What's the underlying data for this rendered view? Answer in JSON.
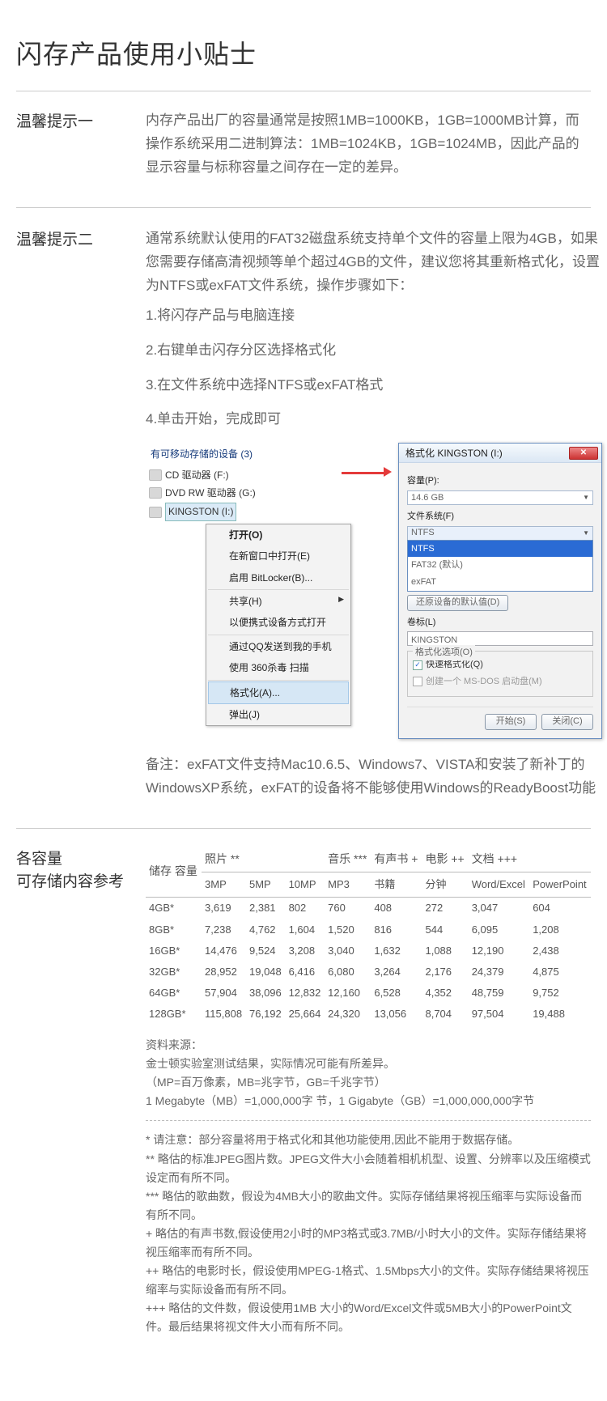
{
  "title": "闪存产品使用小贴士",
  "tip1": {
    "label": "温馨提示一",
    "body": "内存产品出厂的容量通常是按照1MB=1000KB，1GB=1000MB计算，而操作系统采用二进制算法：1MB=1024KB，1GB=1024MB，因此产品的显示容量与标称容量之间存在一定的差异。"
  },
  "tip2": {
    "label": "温馨提示二",
    "intro": "通常系统默认使用的FAT32磁盘系统支持单个文件的容量上限为4GB，如果您需要存储高清视频等单个超过4GB的文件，建议您将其重新格式化，设置为NTFS或exFAT文件系统，操作步骤如下：",
    "step1": "1.将闪存产品与电脑连接",
    "step2": "2.右键单击闪存分区选择格式化",
    "step3": "3.在文件系统中选择NTFS或exFAT格式",
    "step4": "4.单击开始，完成即可",
    "note": "备注：exFAT文件支持Mac10.6.5、Windows7、VISTA和安装了新补丁的WindowsXP系统，exFAT的设备将不能够使用Windows的ReadyBoost功能"
  },
  "context": {
    "devices_header": "有可移动存储的设备 (3)",
    "device_cd": "CD 驱动器 (F:)",
    "device_dvd": "DVD RW 驱动器 (G:)",
    "device_sel": "KINGSTON (I:)",
    "menu": {
      "open": "打开(O)",
      "open_new": "在新窗口中打开(E)",
      "bitlocker": "启用 BitLocker(B)...",
      "share": "共享(H)",
      "portable": "以便携式设备方式打开",
      "qq": "通过QQ发送到我的手机",
      "scan": "使用 360杀毒 扫描",
      "format": "格式化(A)...",
      "eject": "弹出(J)"
    }
  },
  "dialog": {
    "title": "格式化 KINGSTON (I:)",
    "capacity_label": "容量(P):",
    "capacity_value": "14.6 GB",
    "fs_label": "文件系统(F)",
    "fs_sel": "NTFS",
    "fs_opt1": "NTFS",
    "fs_opt2": "FAT32 (默认)",
    "fs_opt3": "exFAT",
    "restore_btn": "还原设备的默认值(D)",
    "vol_label": "卷标(L)",
    "vol_value": "KINGSTON",
    "opts_label": "格式化选项(O)",
    "quick": "快速格式化(Q)",
    "msdos": "创建一个 MS-DOS 启动盘(M)",
    "start": "开始(S)",
    "close": "关闭(C)"
  },
  "capacity": {
    "label_l1": "各容量",
    "label_l2": "可存储内容参考",
    "group": {
      "storage": "储存\n容量",
      "photo": "照片 **",
      "music": "音乐 ***",
      "audio": "有声书 +",
      "movie": "电影 ++",
      "doc": "文档 +++"
    },
    "sub": {
      "p3": "3MP",
      "p5": "5MP",
      "p10": "10MP",
      "mp3": "MP3",
      "book": "书籍",
      "min": "分钟",
      "we": "Word/Excel",
      "ppt": "PowerPoint"
    },
    "rows": [
      {
        "cap": "4GB*",
        "p3": "3,619",
        "p5": "2,381",
        "p10": "802",
        "mp3": "760",
        "book": "408",
        "min": "272",
        "we": "3,047",
        "ppt": "604"
      },
      {
        "cap": "8GB*",
        "p3": "7,238",
        "p5": "4,762",
        "p10": "1,604",
        "mp3": "1,520",
        "book": "816",
        "min": "544",
        "we": "6,095",
        "ppt": "1,208"
      },
      {
        "cap": "16GB*",
        "p3": "14,476",
        "p5": "9,524",
        "p10": "3,208",
        "mp3": "3,040",
        "book": "1,632",
        "min": "1,088",
        "we": "12,190",
        "ppt": "2,438"
      },
      {
        "cap": "32GB*",
        "p3": "28,952",
        "p5": "19,048",
        "p10": "6,416",
        "mp3": "6,080",
        "book": "3,264",
        "min": "2,176",
        "we": "24,379",
        "ppt": "4,875"
      },
      {
        "cap": "64GB*",
        "p3": "57,904",
        "p5": "38,096",
        "p10": "12,832",
        "mp3": "12,160",
        "book": "6,528",
        "min": "4,352",
        "we": "48,759",
        "ppt": "9,752"
      },
      {
        "cap": "128GB*",
        "p3": "115,808",
        "p5": "76,192",
        "p10": "25,664",
        "mp3": "24,320",
        "book": "13,056",
        "min": "8,704",
        "we": "97,504",
        "ppt": "19,488"
      }
    ],
    "source": {
      "l1": "资料来源：",
      "l2": "金士顿实验室测试结果，实际情况可能有所差异。",
      "l3": "（MP=百万像素，MB=兆字节，GB=千兆字节）",
      "l4": "1 Megabyte（MB）=1,000,000字 节，1 Gigabyte（GB）=1,000,000,000字节"
    },
    "foot": {
      "f1": "* 请注意：部分容量将用于格式化和其他功能使用,因此不能用于数据存储。",
      "f2": "** 略估的标准JPEG图片数。JPEG文件大小会随着相机机型、设置、分辨率以及压缩模式设定而有所不同。",
      "f3": "*** 略估的歌曲数，假设为4MB大小的歌曲文件。实际存储结果将视压缩率与实际设备而有所不同。",
      "f4": "+ 略估的有声书数,假设使用2小时的MP3格式或3.7MB/小时大小的文件。实际存储结果将视压缩率而有所不同。",
      "f5": "++ 略估的电影时长，假设使用MPEG-1格式、1.5Mbps大小的文件。实际存储结果将视压缩率与实际设备而有所不同。",
      "f6": "+++ 略估的文件数，假设使用1MB 大小的Word/Excel文件或5MB大小的PowerPoint文件。最后结果将视文件大小而有所不同。"
    }
  }
}
